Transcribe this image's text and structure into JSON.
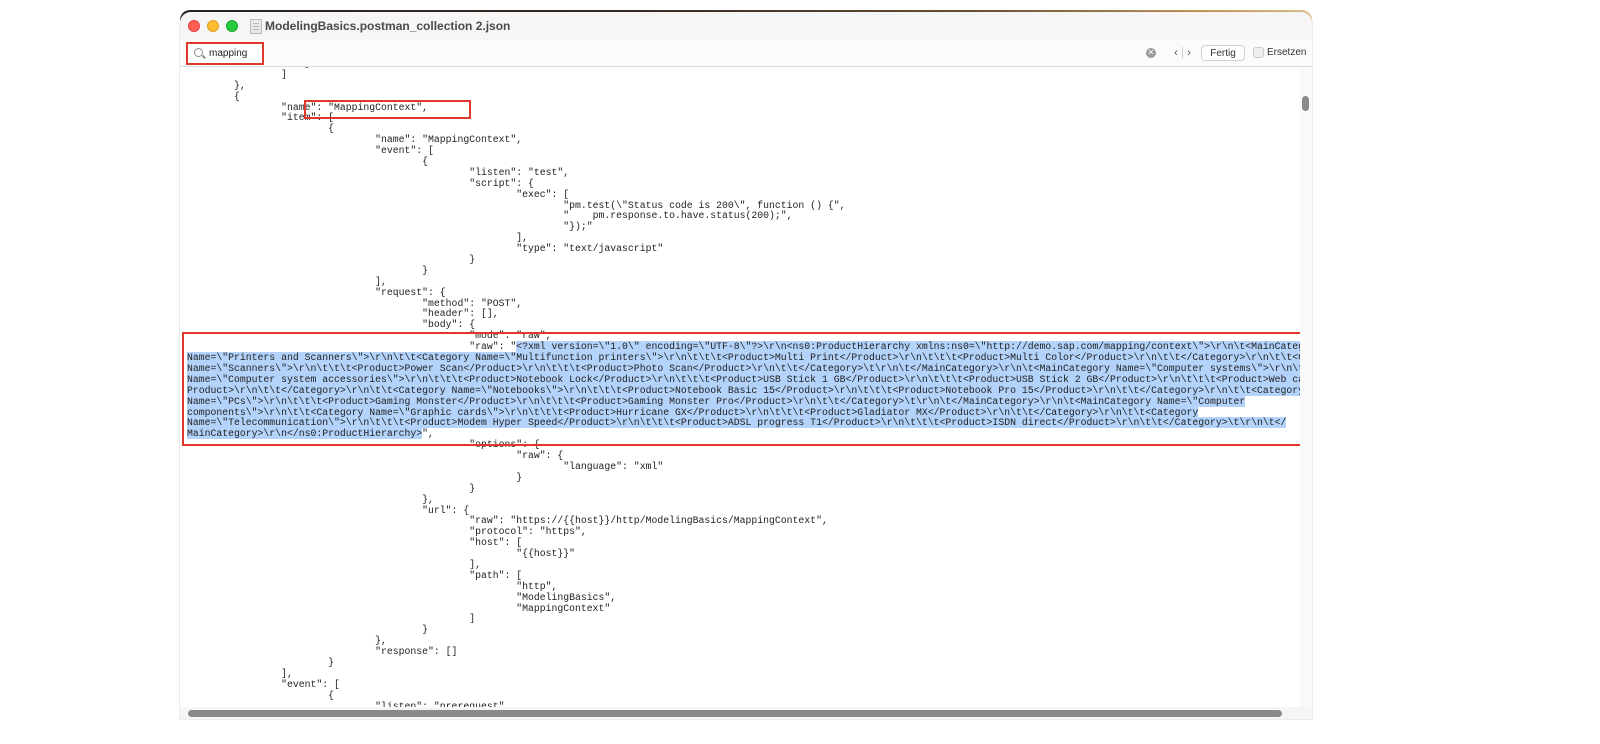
{
  "window": {
    "title": "ModelingBasics.postman_collection 2.json"
  },
  "find_bar": {
    "search_value": "mapping",
    "done_label": "Fertig",
    "replace_label": "Ersetzen"
  },
  "editor": {
    "lines": [
      "                    }",
      "                ]",
      "        },",
      "        {",
      "                \"name\": \"MappingContext\",",
      "                \"item\": [",
      "                        {",
      "                                \"name\": \"MappingContext\",",
      "                                \"event\": [",
      "                                        {",
      "                                                \"listen\": \"test\",",
      "                                                \"script\": {",
      "                                                        \"exec\": [",
      "                                                                \"pm.test(\\\"Status code is 200\\\", function () {\",",
      "                                                                \"    pm.response.to.have.status(200);\",",
      "                                                                \"});\"",
      "                                                        ],",
      "                                                        \"type\": \"text/javascript\"",
      "                                                }",
      "                                        }",
      "                                ],",
      "                                \"request\": {",
      "                                        \"method\": \"POST\",",
      "                                        \"header\": [],",
      "                                        \"body\": {",
      "                                                \"mode\": \"raw\",",
      "                                                \"raw\": \"",
      "",
      "",
      "",
      "",
      "",
      "",
      "",
      "",
      "                                                \"options\": {",
      "                                                        \"raw\": {",
      "                                                                \"language\": \"xml\"",
      "                                                        }",
      "                                                }",
      "                                        },",
      "                                        \"url\": {",
      "                                                \"raw\": \"https://{{host}}/http/ModelingBasics/MappingContext\",",
      "                                                \"protocol\": \"https\",",
      "                                                \"host\": [",
      "                                                        \"{{host}}\"",
      "                                                ],",
      "                                                \"path\": [",
      "                                                        \"http\",",
      "                                                        \"ModelingBasics\",",
      "                                                        \"MappingContext\"",
      "                                                ]",
      "                                        }",
      "                                },",
      "                                \"response\": []",
      "                        }",
      "                ],",
      "                \"event\": [",
      "                        {",
      "                                \"listen\": \"prerequest\","
    ],
    "raw_selection_lines": [
      "<?xml version=\\\"1.0\\\" encoding=\\\"UTF-8\\\"?>\\r\\n<ns0:ProductHierarchy xmlns:ns0=\\\"http://demo.sap.com/mapping/context\\\">\\r\\n\\t<MainCategory",
      "Name=\\\"Printers and Scanners\\\">\\r\\n\\t\\t<Category Name=\\\"Multifunction printers\\\">\\r\\n\\t\\t\\t<Product>Multi Print</Product>\\r\\n\\t\\t\\t<Product>Multi Color</Product>\\r\\n\\t\\t</Category>\\r\\n\\t\\t<Category",
      "Name=\\\"Scanners\\\">\\r\\n\\t\\t\\t<Product>Power Scan</Product>\\r\\n\\t\\t\\t<Product>Photo Scan</Product>\\r\\n\\t\\t</Category>\\t\\r\\n\\t</MainCategory>\\r\\n\\t<MainCategory Name=\\\"Computer systems\\\">\\r\\n\\t\\t<Category",
      "Name=\\\"Computer system accessories\\\">\\r\\n\\t\\t\\t<Product>Notebook Lock</Product>\\r\\n\\t\\t\\t<Product>USB Stick 1 GB</Product>\\r\\n\\t\\t\\t<Product>USB Stick 2 GB</Product>\\r\\n\\t\\t\\t<Product>Web cam reality</",
      "Product>\\r\\n\\t\\t</Category>\\r\\n\\t\\t<Category Name=\\\"Notebooks\\\">\\r\\n\\t\\t\\t<Product>Notebook Basic 15</Product>\\r\\n\\t\\t\\t<Product>Notebook Pro 15</Product>\\r\\n\\t\\t</Category>\\r\\n\\t\\t<Category",
      "Name=\\\"PCs\\\">\\r\\n\\t\\t\\t<Product>Gaming Monster</Product>\\r\\n\\t\\t\\t<Product>Gaming Monster Pro</Product>\\r\\n\\t\\t</Category>\\t\\r\\n\\t</MainCategory>\\r\\n\\t<MainCategory Name=\\\"Computer",
      "components\\\">\\r\\n\\t\\t<Category Name=\\\"Graphic cards\\\">\\r\\n\\t\\t\\t<Product>Hurricane GX</Product>\\r\\n\\t\\t\\t<Product>Gladiator MX</Product>\\r\\n\\t\\t</Category>\\r\\n\\t\\t<Category",
      "Name=\\\"Telecommunication\\\">\\r\\n\\t\\t\\t<Product>Modem Hyper Speed</Product>\\r\\n\\t\\t\\t<Product>ADSL progress T1</Product>\\r\\n\\t\\t\\t<Product>ISDN direct</Product>\\r\\n\\t\\t</Category>\\t\\r\\n\\t</",
      "MainCategory>\\r\\n</ns0:ProductHierarchy>"
    ],
    "raw_closing": "\","
  },
  "colors": {
    "highlight_box": "#e0392b",
    "selection": "#b3d3fb"
  },
  "icons": [
    "search-icon",
    "clear-search-icon",
    "chevron-left-icon",
    "chevron-right-icon",
    "document-icon"
  ]
}
